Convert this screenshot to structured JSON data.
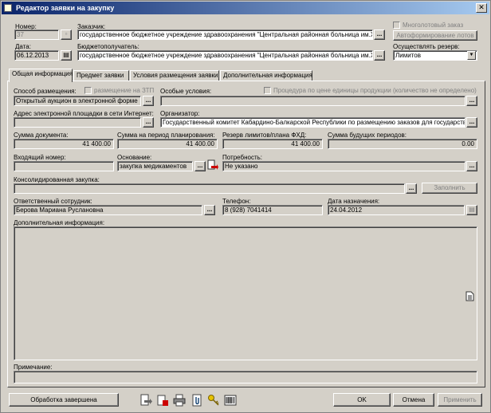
{
  "window": {
    "title": "Редактор заявки на закупку"
  },
  "header": {
    "number_label": "Номер:",
    "number_value": "37",
    "date_label": "Дата:",
    "date_value": "06.12.2013",
    "customer_label": "Заказчик:",
    "customer_value": "государственное бюджетное учреждение здравоохранения \"Центральная районная больница им.Хаш",
    "recipient_label": "Бюджетополучатель:",
    "recipient_value": "государственное бюджетное учреждение здравоохранения \"Центральная районная больница им.Хаш",
    "multilot_label": "Многолотовый заказ",
    "autolots_label": "Автоформирование лотов",
    "reserve_label": "Осуществлять резерв:",
    "reserve_value": "Лимитов"
  },
  "tabs": [
    "Общая информация",
    "Предмет заявки",
    "Условия размещения заявки",
    "Дополнительная информация"
  ],
  "general": {
    "placement_label": "Способ размещения:",
    "placement_value": "Открытый аукцион в электронной форме",
    "ztp_label": "размещение на ЗТП",
    "special_label": "Особые условия:",
    "special_value": "",
    "unit_price_label": "Процедура по цене единицы продукции (количество не определено)",
    "site_label": "Адрес электронной площадки в сети Интернет:",
    "site_value": "",
    "organizer_label": "Организатор:",
    "organizer_value": "Государственный комитет Кабардино-Балкарской Республики по размещению заказов для государств",
    "doc_sum_label": "Сумма документа:",
    "doc_sum_value": "41 400.00",
    "plan_sum_label": "Сумма на период планирования:",
    "plan_sum_value": "41 400.00",
    "reserve_sum_label": "Резерв лимитов/плана ФХД:",
    "reserve_sum_value": "41 400.00",
    "future_sum_label": "Сумма будущих периодов:",
    "future_sum_value": "0.00",
    "incoming_label": "Входящий номер:",
    "incoming_value": "",
    "basis_label": "Основание:",
    "basis_value": "закупка медикаментов",
    "need_label": "Потребность:",
    "need_value": "Не указано",
    "consolidated_label": "Консолидированная закупка:",
    "consolidated_value": "",
    "fill_button": "Заполнить",
    "responsible_label": "Ответственный сотрудник:",
    "responsible_value": "Берова Мариана Руслановна",
    "phone_label": "Телефон:",
    "phone_value": "8 (928) 7041414",
    "assign_date_label": "Дата назначения:",
    "assign_date_value": "24.04.2012",
    "additional_label": "Дополнительная информация:",
    "additional_value": "",
    "note_label": "Примечание:",
    "note_value": ""
  },
  "footer": {
    "done_button": "Обработка завершена",
    "ok_button": "OK",
    "cancel_button": "Отмена",
    "apply_button": "Применить"
  }
}
